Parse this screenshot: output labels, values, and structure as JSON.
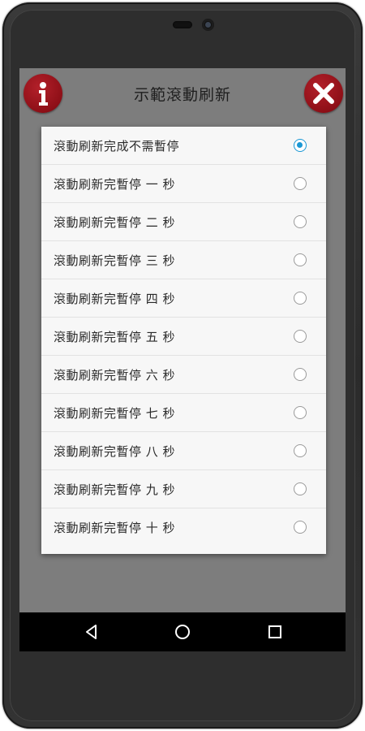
{
  "app": {
    "title": "示範滾動刷新"
  },
  "header_buttons": {
    "info_icon": "info-icon",
    "close_icon": "close-icon",
    "button_color": "#9a1520"
  },
  "dialog": {
    "accent_color": "#1a97d4",
    "options": [
      {
        "label": "滾動刷新完成不需暫停",
        "selected": true
      },
      {
        "label": "滾動刷新完暫停 一 秒",
        "selected": false
      },
      {
        "label": "滾動刷新完暫停 二 秒",
        "selected": false
      },
      {
        "label": "滾動刷新完暫停 三 秒",
        "selected": false
      },
      {
        "label": "滾動刷新完暫停 四 秒",
        "selected": false
      },
      {
        "label": "滾動刷新完暫停 五 秒",
        "selected": false
      },
      {
        "label": "滾動刷新完暫停 六 秒",
        "selected": false
      },
      {
        "label": "滾動刷新完暫停 七 秒",
        "selected": false
      },
      {
        "label": "滾動刷新完暫停 八 秒",
        "selected": false
      },
      {
        "label": "滾動刷新完暫停 九 秒",
        "selected": false
      },
      {
        "label": "滾動刷新完暫停 十 秒",
        "selected": false
      }
    ]
  },
  "navbar": {
    "icons": [
      "back-icon",
      "home-icon",
      "recents-icon"
    ]
  }
}
